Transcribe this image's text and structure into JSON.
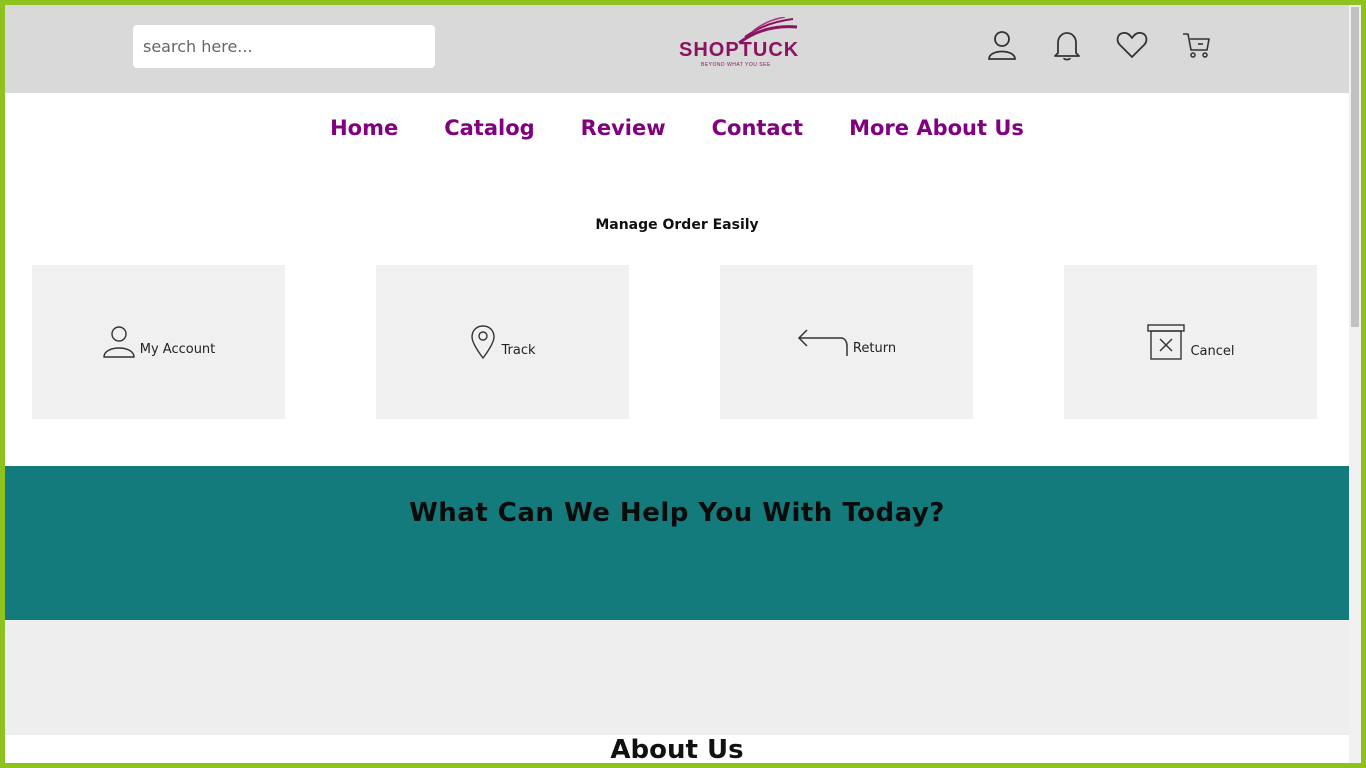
{
  "header": {
    "search_placeholder": "search here...",
    "logo_text": "SHOPTUCK",
    "logo_tagline": "BEYOND WHAT YOU SEE",
    "icons": [
      "user-icon",
      "bell-icon",
      "heart-icon",
      "cart-icon"
    ]
  },
  "nav": {
    "items": [
      "Home",
      "Catalog",
      "Review",
      "Contact",
      "More About Us"
    ]
  },
  "manage": {
    "title": "Manage Order Easily",
    "cards": [
      {
        "label": "My Account",
        "icon": "user-icon"
      },
      {
        "label": "Track",
        "icon": "location-pin-icon"
      },
      {
        "label": "Return",
        "icon": "return-arrow-icon"
      },
      {
        "label": "Cancel",
        "icon": "cancel-box-icon"
      }
    ]
  },
  "help": {
    "title": "What Can We Help You With Today?"
  },
  "about": {
    "title": "About Us"
  },
  "colors": {
    "border": "#8dc21f",
    "topbar": "#d9d9d9",
    "nav_link": "#800080",
    "brand": "#8b1460",
    "help_band": "#137b7b",
    "card_bg": "#f0f0f0"
  }
}
